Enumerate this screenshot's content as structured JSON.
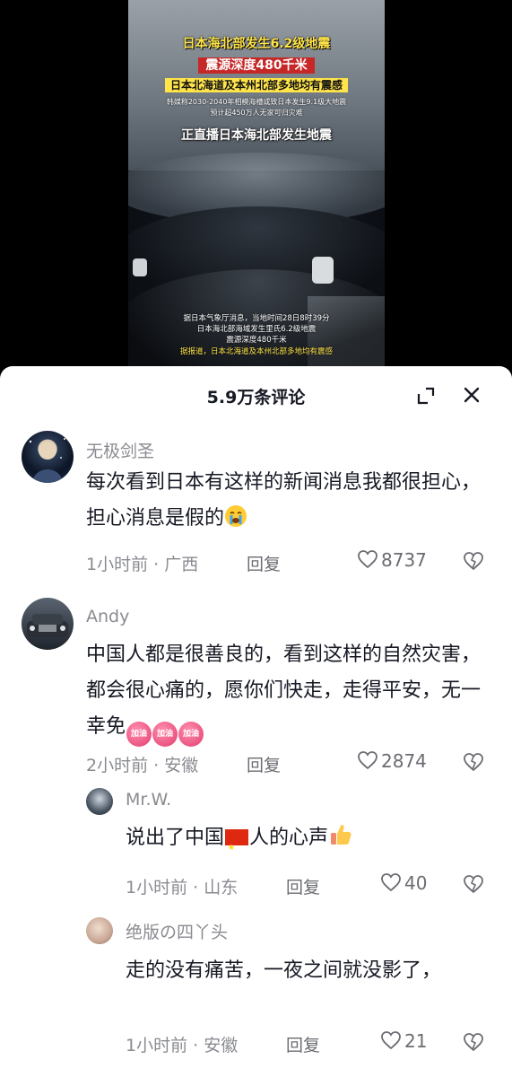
{
  "video": {
    "title_line1": "日本海北部发生6.2级地震",
    "title_line2": "震源深度480千米",
    "title_line3": "日本北海道及本州北部多地均有震感",
    "small_line1": "韩媒称2030-2040年相模海槽或致日本发生9.1级大地震",
    "small_line2": "预计超450万人无家可归灾难",
    "live_line": "正直播日本海北部发生地震",
    "caption_lines": [
      "据日本气象厅消息，当地时间28日8时39分",
      "日本海北部海域发生里氏6.2级地震",
      "震源深度480千米",
      "据报道，日本北海道及本州北部多地均有震感"
    ]
  },
  "sheet": {
    "comment_count_label": "5.9万条评论"
  },
  "comments": [
    {
      "username": "无极剑圣",
      "text": "每次看到日本有这样的新闻消息我都很担心，担心消息是假的",
      "emoji": "crying-face",
      "time": "1小时前",
      "location": "广西",
      "reply_label": "回复",
      "likes": "8737"
    },
    {
      "username": "Andy",
      "text": "中国人都是很善良的，看到这样的自然灾害，都会很心痛的，愿你们快走，走得平安，无一幸免",
      "badge_text": "加油",
      "time": "2小时前",
      "location": "安徽",
      "reply_label": "回复",
      "likes": "2874"
    },
    {
      "username": "Mr.W.",
      "text_before_flag": "说出了中国",
      "text_after_flag": "人的心声",
      "emoji": "thumbs-up",
      "time": "1小时前",
      "location": "山东",
      "reply_label": "回复",
      "likes": "40"
    },
    {
      "username": "绝版の四丫头",
      "text": "走的没有痛苦，一夜之间就没影了，",
      "time": "1小时前",
      "location": "安徽",
      "reply_label": "回复",
      "likes": "21"
    }
  ]
}
